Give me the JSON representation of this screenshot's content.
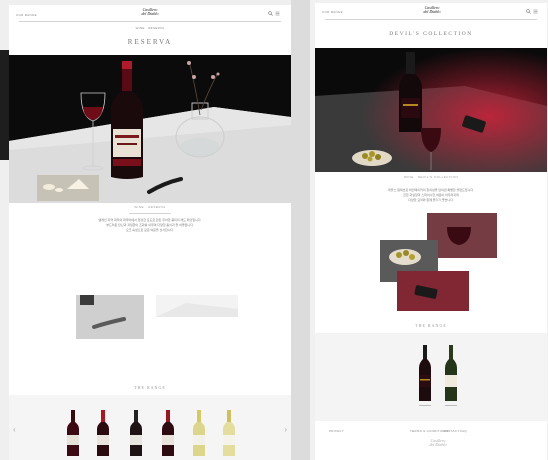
{
  "left_page": {
    "header": {
      "nav_label": "OUR RANGE",
      "logo_line1": "Casillero",
      "logo_line2": "del Diablo"
    },
    "title": "RESERVA",
    "breadcrumb": "WINE · RESERVA",
    "hero_caption": "WINE · RESERVA",
    "body_text": [
      "멜레인 지역 최적의 테루아에서 엄선한 포도로 만든 우아한 풍미의 레드 와인입니다.",
      "부드러운 탄닌과 과일향이 조화를 이루며 다양한 음식과 잘 어울립니다.",
      "오크 숙성으로 깊은 여운을 선사합니다."
    ],
    "range_title": "THE RANGE",
    "nav_prev": "‹",
    "nav_next": "›"
  },
  "right_page": {
    "header": {
      "nav_label": "OUR RANGE",
      "logo_line1": "Casillero",
      "logo_line2": "del Diablo"
    },
    "title": "DEVIL'S COLLECTION",
    "hero_caption": "WINE · DEVIL'S COLLECTION",
    "body_text": [
      "데블스 컬렉션은 와인메이커의 창의성을 담아낸 특별한 블렌드입니다.",
      "진한 과실향과 스파이시한 여운이 어우러지며",
      "다양한 요리와 함께 즐기기 좋습니다."
    ],
    "range_title": "THE RANGE",
    "footer_links": [
      "PRIVACY",
      "TERMS & CONDITIONS",
      "CONTACT",
      "FAQ"
    ],
    "footer_logo_line1": "Casillero",
    "footer_logo_line2": "del Diablo"
  },
  "colors": {
    "dark": "#0b0b0b",
    "wine_red": "#8a1020",
    "accent_red": "#c8233a",
    "text_grey": "#777777"
  }
}
